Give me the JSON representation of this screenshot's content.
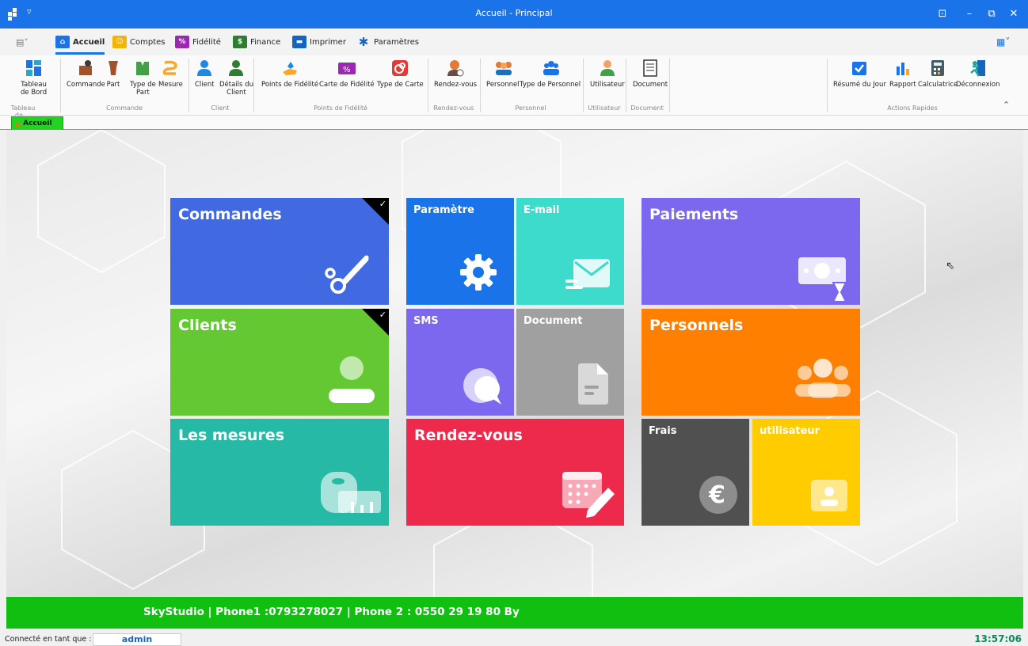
{
  "window": {
    "title": "Accueil - Principal"
  },
  "tabs": [
    {
      "label": "Accueil",
      "icon": "home-sewing-icon",
      "color": "#1a73e8"
    },
    {
      "label": "Comptes",
      "icon": "user-circle-icon",
      "color": "#f4b400"
    },
    {
      "label": "Fidélité",
      "icon": "percent-card-icon",
      "color": "#9c27b0"
    },
    {
      "label": "Finance",
      "icon": "dollar-icon",
      "color": "#2e7d32"
    },
    {
      "label": "Imprimer",
      "icon": "printer-icon",
      "color": "#1565c0"
    },
    {
      "label": "Paramètres",
      "icon": "gear-icon",
      "color": "#1565c0"
    }
  ],
  "ribbon": {
    "buttons": {
      "tableau": "Tableau\nde Bord",
      "commande": "Commande",
      "part": "Part",
      "type_part": "Type de\nPart",
      "mesure": "Mesure",
      "client": "Client",
      "details_client": "Détails du\nClient",
      "points": "Points de Fidélité",
      "carte": "Carte de Fidélité",
      "type_carte": "Type de Carte",
      "rdv": "Rendez-vous",
      "personnel": "Personnel",
      "type_personnel": "Type de Personnel",
      "utilisateur": "Utilisateur",
      "document": "Document",
      "resume": "Résumé du Jour",
      "rapport": "Rapport",
      "calculatrice": "Calculatrice",
      "deconnexion": "Déconnexion"
    },
    "groups": {
      "tableau": "Tableau de ...",
      "commande": "Commande",
      "client": "Client",
      "points": "Points de Fidélité",
      "rdv": "Rendez-vous",
      "personnel": "Personnel",
      "utilisateur": "Utilisateur",
      "document": "Document",
      "actions": "Actions Rapides"
    }
  },
  "doc_tab": {
    "label": "Accueil"
  },
  "tiles": {
    "commandes": {
      "label": "Commandes",
      "color": "#4169e1"
    },
    "parametre": {
      "label": "Paramètre",
      "color": "#1a73e8"
    },
    "email": {
      "label": "E-mail",
      "color": "#3ddbcb"
    },
    "paiements": {
      "label": "Paiements",
      "color": "#7b68ee"
    },
    "clients": {
      "label": "Clients",
      "color": "#64c832"
    },
    "sms": {
      "label": "SMS",
      "color": "#7b68ee"
    },
    "document": {
      "label": "Document",
      "color": "#a0a0a0"
    },
    "personnels": {
      "label": "Personnels",
      "color": "#ff7f00"
    },
    "mesures": {
      "label": "Les mesures",
      "color": "#26b9a5"
    },
    "rendezvous": {
      "label": "Rendez-vous",
      "color": "#ee2a4c"
    },
    "frais": {
      "label": "Frais",
      "color": "#505050"
    },
    "utilisateur": {
      "label": "utilisateur",
      "color": "#ffcc00"
    }
  },
  "footer": {
    "text": "SkyStudio |  Phone1 :0793278027  | Phone 2 : 0550 29 19 80 By"
  },
  "status": {
    "connected_label": "Connecté en tant que :",
    "user": "admin",
    "time": "13:57:06"
  }
}
